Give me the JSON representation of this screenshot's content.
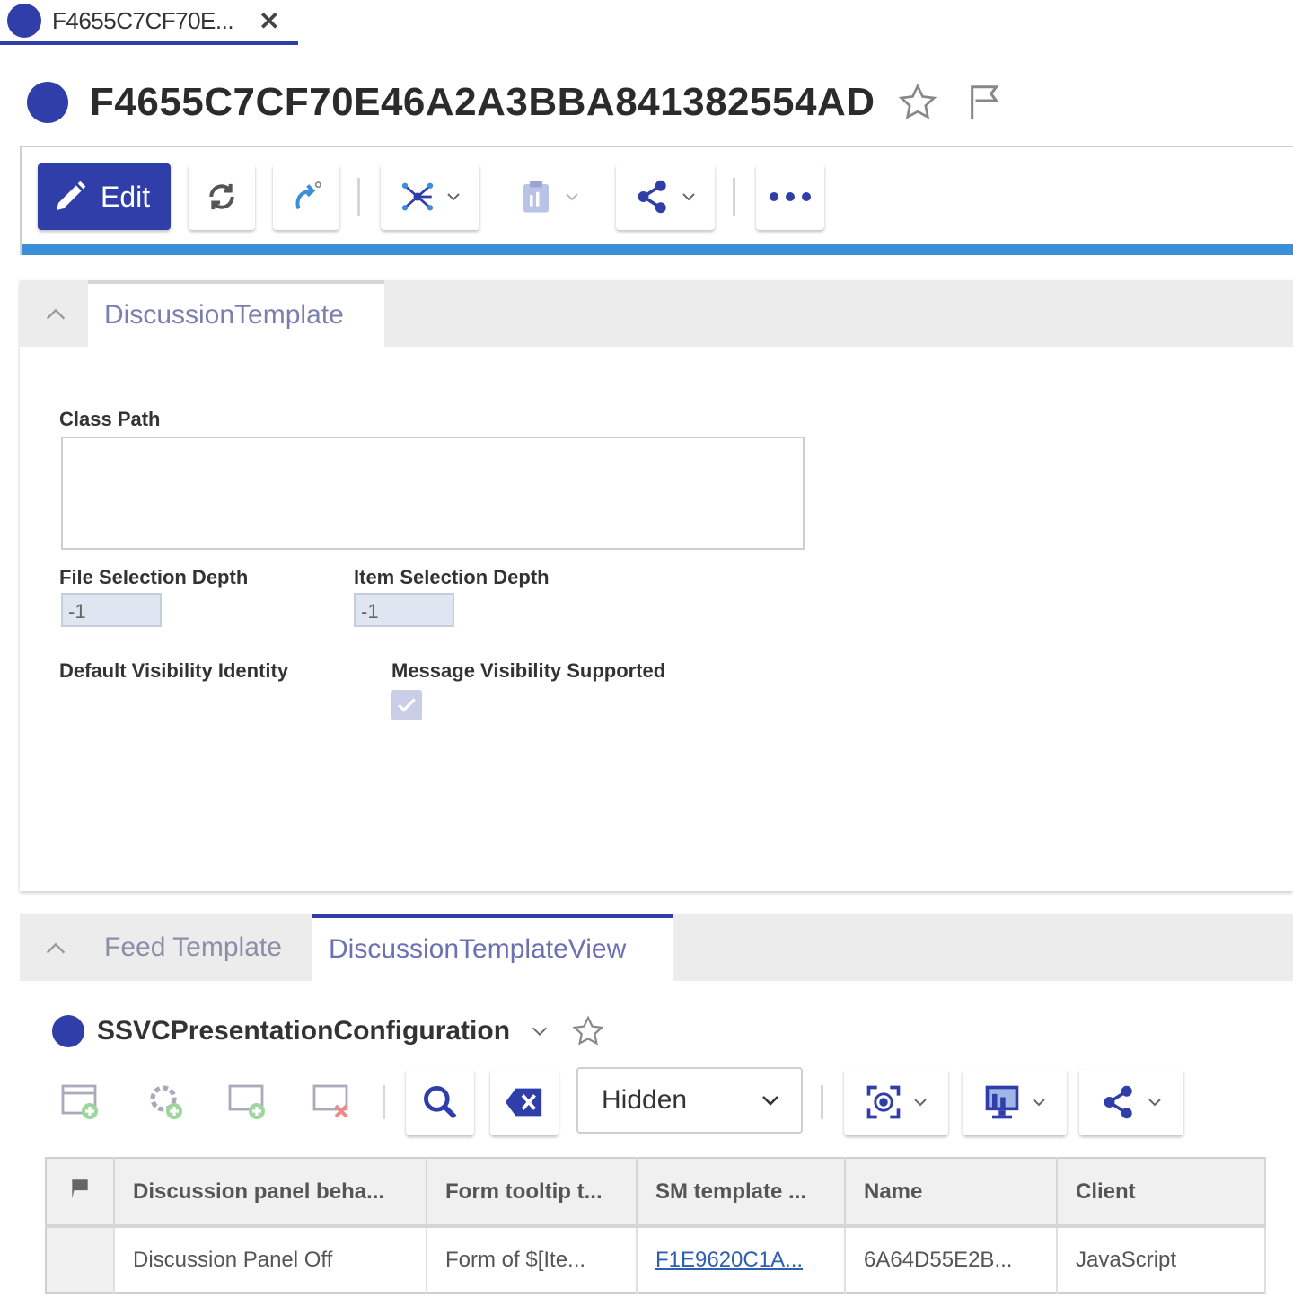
{
  "tab": {
    "title": "F4655C7CF70E..."
  },
  "header": {
    "title": "F4655C7CF70E46A2A3BBA841382554AD"
  },
  "toolbar": {
    "edit_label": "Edit"
  },
  "section1": {
    "tab_label": "DiscussionTemplate",
    "class_path_label": "Class Path",
    "file_depth_label": "File Selection Depth",
    "file_depth_value": "-1",
    "item_depth_label": "Item Selection Depth",
    "item_depth_value": "-1",
    "default_visibility_label": "Default Visibility Identity",
    "message_visibility_label": "Message Visibility Supported",
    "message_visibility_checked": true
  },
  "section2": {
    "tabs": [
      {
        "label": "Feed Template"
      },
      {
        "label": "DiscussionTemplateView"
      }
    ],
    "sub_title": "SSVCPresentationConfiguration",
    "filter_value": "Hidden",
    "table": {
      "columns": [
        "Discussion panel beha...",
        "Form tooltip t...",
        "SM template ...",
        "Name",
        "Client"
      ],
      "rows": [
        [
          "Discussion Panel Off",
          "Form of $[Ite...",
          "F1E9620C1A...",
          "6A64D55E2B...",
          "JavaScript"
        ]
      ]
    }
  },
  "colors": {
    "brand": "#2f3ea8",
    "accent": "#3a8fd6"
  }
}
